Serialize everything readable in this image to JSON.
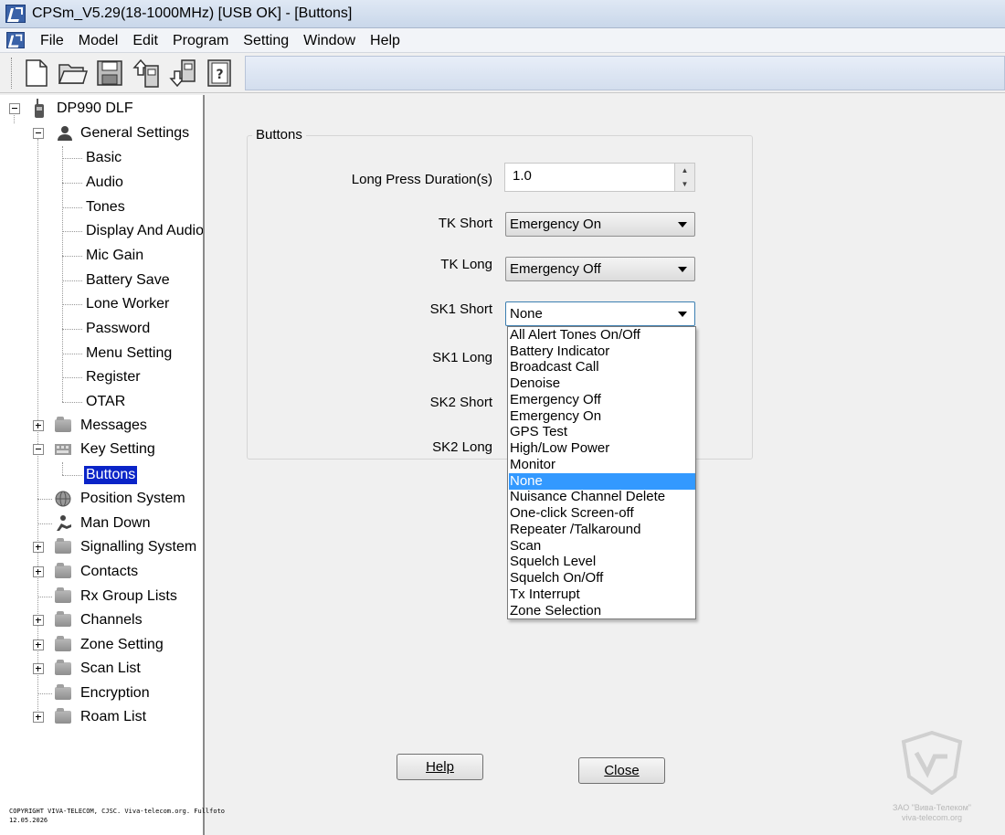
{
  "window": {
    "title": "CPSm_V5.29(18-1000MHz) [USB OK] - [Buttons]"
  },
  "menu": [
    "File",
    "Model",
    "Edit",
    "Program",
    "Setting",
    "Window",
    "Help"
  ],
  "toolbar": {
    "icons": [
      "new-file-icon",
      "open-folder-icon",
      "save-icon",
      "read-from-radio-icon",
      "write-to-radio-icon",
      "help-book-icon"
    ]
  },
  "tree": {
    "root": "DP990 DLF",
    "general_settings": "General Settings",
    "general_children": [
      "Basic",
      "Audio",
      "Tones",
      "Display And Audio",
      "Mic Gain",
      "Battery Save",
      "Lone Worker",
      "Password",
      "Menu Setting",
      "Register",
      "OTAR"
    ],
    "messages": "Messages",
    "key_setting": "Key Setting",
    "buttons": "Buttons",
    "position_system": "Position System",
    "man_down": "Man Down",
    "signalling_system": "Signalling System",
    "contacts": "Contacts",
    "rx_group_lists": "Rx Group Lists",
    "channels": "Channels",
    "zone_setting": "Zone Setting",
    "scan_list": "Scan List",
    "encryption": "Encryption",
    "roam_list": "Roam List"
  },
  "form": {
    "group_title": "Buttons",
    "long_press_label": "Long Press Duration(s)",
    "long_press_value": "1.0",
    "tk_short_label": "TK Short",
    "tk_short_value": "Emergency On",
    "tk_long_label": "TK Long",
    "tk_long_value": "Emergency Off",
    "sk1_short_label": "SK1 Short",
    "sk1_short_value": "None",
    "sk1_long_label": "SK1 Long",
    "sk2_short_label": "SK2 Short",
    "sk2_long_label": "SK2 Long"
  },
  "dropdown": {
    "options": [
      "All Alert Tones On/Off",
      "Battery Indicator",
      "Broadcast Call",
      "Denoise",
      "Emergency Off",
      "Emergency On",
      "GPS Test",
      "High/Low Power",
      "Monitor",
      "None",
      "Nuisance Channel Delete",
      "One-click Screen-off",
      "Repeater /Talkaround",
      "Scan",
      "Squelch Level",
      "Squelch On/Off",
      "Tx Interrupt",
      "Zone Selection"
    ],
    "highlighted": "None"
  },
  "buttons": {
    "help": "Help",
    "close": "Close"
  },
  "footer": {
    "copyright_line1": "COPYRIGHT VIVA-TELECOM, CJSC. Viva-telecom.org. Fullfoto",
    "copyright_line2": "12.05.2026",
    "watermark_line1": "ЗАО \"Вива-Телеком\"",
    "watermark_line2": "viva-telecom.org"
  },
  "colors": {
    "selection": "#0a24c8",
    "highlight": "#3399ff",
    "combo_focus": "#3c7fb1"
  }
}
